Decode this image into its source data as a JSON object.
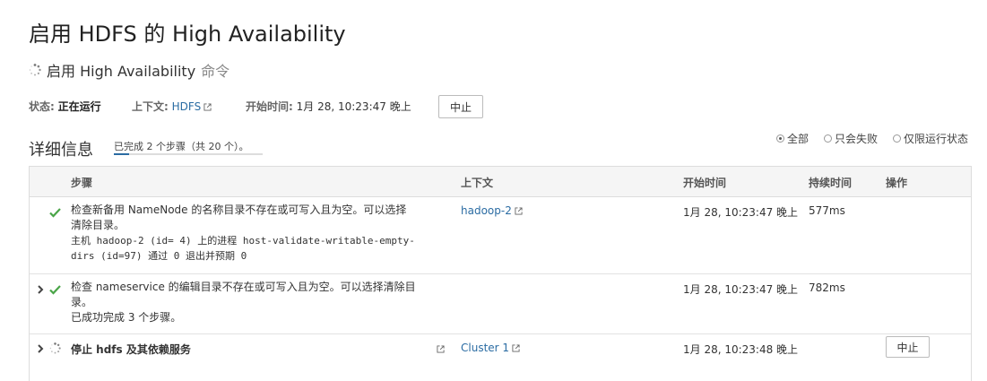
{
  "page_title": "启用 HDFS 的 High Availability",
  "command": {
    "title": "启用 High Availability",
    "suffix": "命令"
  },
  "meta": {
    "status_label": "状态:",
    "status_value": "正在运行",
    "context_label": "上下文:",
    "context_value": "HDFS",
    "start_label": "开始时间:",
    "start_value": "1月 28, 10:23:47 晚上",
    "abort_label": "中止"
  },
  "details": {
    "title": "详细信息",
    "progress_text": "已完成 2 个步骤（共 20 个）。",
    "progress_fraction": 0.1
  },
  "filters": [
    {
      "label": "全部",
      "selected": true
    },
    {
      "label": "只会失败",
      "selected": false
    },
    {
      "label": "仅限运行状态",
      "selected": false
    }
  ],
  "table": {
    "headers": {
      "step": "步骤",
      "context": "上下文",
      "start": "开始时间",
      "duration": "持续时间",
      "actions": "操作"
    },
    "rows": [
      {
        "status": "success",
        "title_line1": "检查新备用 NameNode 的名称目录不存在或可写入且为空。可以选择",
        "title_line2": "清除目录。",
        "detail_line1": "主机 hadoop-2 (id= 4) 上的进程 host-validate-writable-empty-",
        "detail_line2": "dirs (id=97) 通过 0 退出并预期 0",
        "context": "hadoop-2",
        "start": "1月 28, 10:23:47 晚上",
        "duration": "577ms"
      },
      {
        "status": "success",
        "title_line1": "检查 nameservice 的编辑目录不存在或可写入且为空。可以选择清除目",
        "title_line2": "录。",
        "detail": "已成功完成 3 个步骤。",
        "start": "1月 28, 10:23:47 晚上",
        "duration": "782ms"
      },
      {
        "status": "running",
        "title": "停止 hdfs 及其依赖服务",
        "context": "Cluster 1",
        "start": "1月 28, 10:23:48 晚上",
        "action": "中止"
      }
    ]
  }
}
